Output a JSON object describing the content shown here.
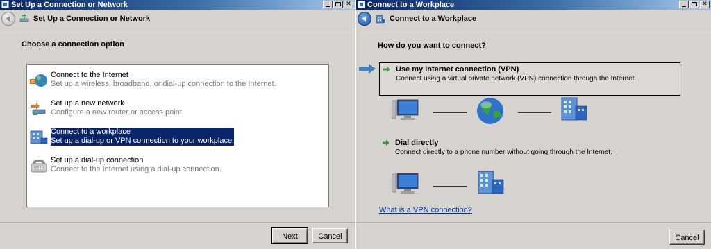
{
  "left_window": {
    "title": "Set Up a Connection or Network",
    "header_title": "Set Up a Connection or Network",
    "heading": "Choose a connection option",
    "options": [
      {
        "title": "Connect to the Internet",
        "desc": "Set up a wireless, broadband, or dial-up connection to the Internet.",
        "icon": "globe-network-icon",
        "selected": false
      },
      {
        "title": "Set up a new network",
        "desc": "Configure a new router or access point.",
        "icon": "router-icon",
        "selected": false
      },
      {
        "title": "Connect to a workplace",
        "desc": "Set up a dial-up or VPN connection to your workplace.",
        "icon": "workplace-icon",
        "selected": true
      },
      {
        "title": "Set up a dial-up connection",
        "desc": "Connect to the Internet using a dial-up connection.",
        "icon": "phone-modem-icon",
        "selected": false
      }
    ],
    "buttons": {
      "next": "Next",
      "cancel": "Cancel"
    }
  },
  "right_window": {
    "title": "Connect to a Workplace",
    "header_title": "Connect to a Workplace",
    "heading": "How do you want to connect?",
    "options": [
      {
        "title": "Use my Internet connection (VPN)",
        "desc": "Connect using a virtual private network (VPN) connection through the Internet."
      },
      {
        "title": "Dial directly",
        "desc": "Connect directly to a phone number without going through the Internet."
      }
    ],
    "link": "What is a VPN connection?",
    "buttons": {
      "cancel": "Cancel"
    }
  },
  "colors": {
    "titlebar_start": "#0a246a",
    "selection": "#0a246a",
    "link": "#0033aa",
    "dialog_bg": "#d6d3ce"
  }
}
